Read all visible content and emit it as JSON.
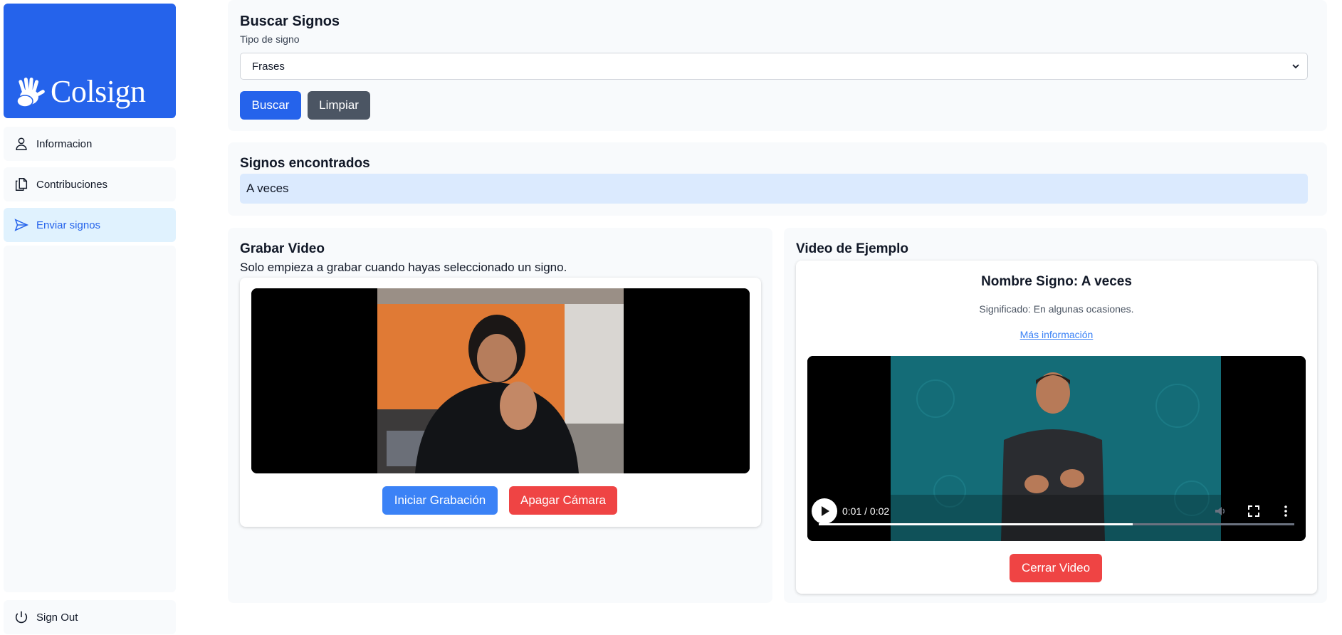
{
  "brand": {
    "name": "Colsign",
    "color": "#2563eb"
  },
  "sidebar": {
    "items": [
      {
        "label": "Informacion",
        "icon": "user-icon"
      },
      {
        "label": "Contribuciones",
        "icon": "documents-icon"
      },
      {
        "label": "Enviar signos",
        "icon": "send-icon",
        "active": true
      }
    ],
    "signout": {
      "label": "Sign Out",
      "icon": "power-icon"
    }
  },
  "search": {
    "title": "Buscar Signos",
    "type_label": "Tipo de signo",
    "selected": "Frases",
    "search_button": "Buscar",
    "clear_button": "Limpiar"
  },
  "results": {
    "title": "Signos encontrados",
    "items": [
      "A veces"
    ]
  },
  "record": {
    "title": "Grabar Video",
    "instruction": "Solo empieza a grabar cuando hayas seleccionado un signo.",
    "start_button": "Iniciar Grabación",
    "stop_camera_button": "Apagar Cámara"
  },
  "example": {
    "title": "Video de Ejemplo",
    "sign_name": "Nombre Signo: A veces",
    "meaning": "Significado: En algunas ocasiones.",
    "more_info": "Más información",
    "time": "0:01 / 0:02",
    "progress": 0.66,
    "close_button": "Cerrar Video"
  },
  "colors": {
    "primary": "#2563eb",
    "secondary": "#4b5563",
    "record": "#3b82f6",
    "danger": "#ef4444",
    "video_bg": "#146c77"
  }
}
